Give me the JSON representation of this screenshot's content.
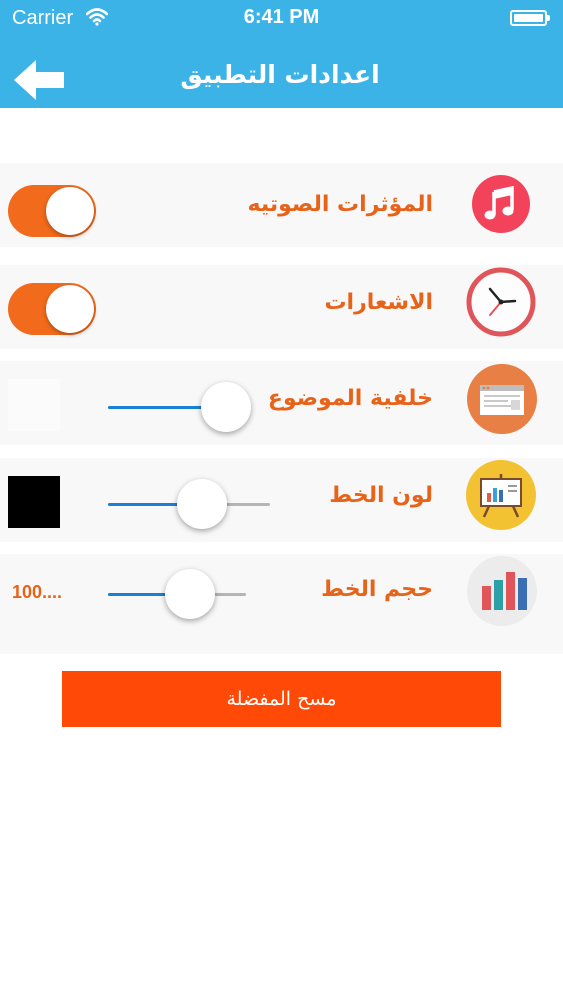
{
  "status_bar": {
    "carrier": "Carrier",
    "time": "6:41 PM"
  },
  "nav": {
    "title": "اعدادات التطبيق"
  },
  "settings": {
    "sound_effects": {
      "label": "المؤثرات الصوتيه",
      "icon": "music-note-icon",
      "enabled": true
    },
    "notifications": {
      "label": "الاشعارات",
      "icon": "clock-icon",
      "enabled": true
    },
    "theme_background": {
      "label": "خلفية الموضوع",
      "icon": "browser-window-icon",
      "level": 0.82,
      "swatch_color": "#fbfbfb"
    },
    "font_color": {
      "label": "لون الخط",
      "icon": "presentation-board-icon",
      "level": 0.5,
      "swatch_color": "#000000"
    },
    "font_size": {
      "label": "حجم الخط",
      "icon": "bar-chart-icon",
      "level": 0.5,
      "value": "100...."
    }
  },
  "clear_favorites": {
    "label": "مسح المفضلة"
  },
  "colors": {
    "header": "#3bb3e7",
    "accent_orange": "#f26a1b",
    "button_red_orange": "#ff4a07",
    "slider_blue": "#1a7fd6"
  }
}
